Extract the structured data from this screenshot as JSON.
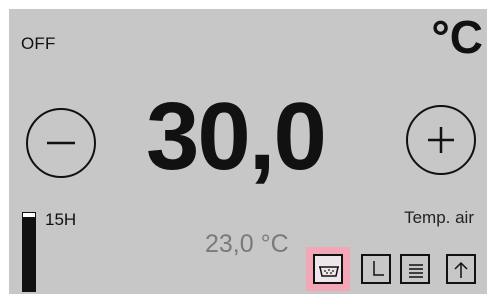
{
  "status": {
    "power": "OFF",
    "unit": "°C"
  },
  "setpoint": {
    "value": "30,0"
  },
  "controls": {
    "decrease_icon": "minus-icon",
    "increase_icon": "plus-icon"
  },
  "timer": {
    "label": "15H",
    "level": 0.95
  },
  "sensor": {
    "label": "Temp. air",
    "measured": "23,0 °C"
  },
  "toolbar": {
    "items": [
      {
        "icon": "bath-icon",
        "active": true
      },
      {
        "icon": "clock-icon",
        "active": false
      },
      {
        "icon": "menu-icon",
        "active": false
      },
      {
        "icon": "arrow-up-icon",
        "active": false
      }
    ]
  },
  "colors": {
    "background": "#c7c7c7",
    "foreground": "#111111",
    "measured_text": "#7a7a7a",
    "active_highlight": "#f2a6b6"
  }
}
